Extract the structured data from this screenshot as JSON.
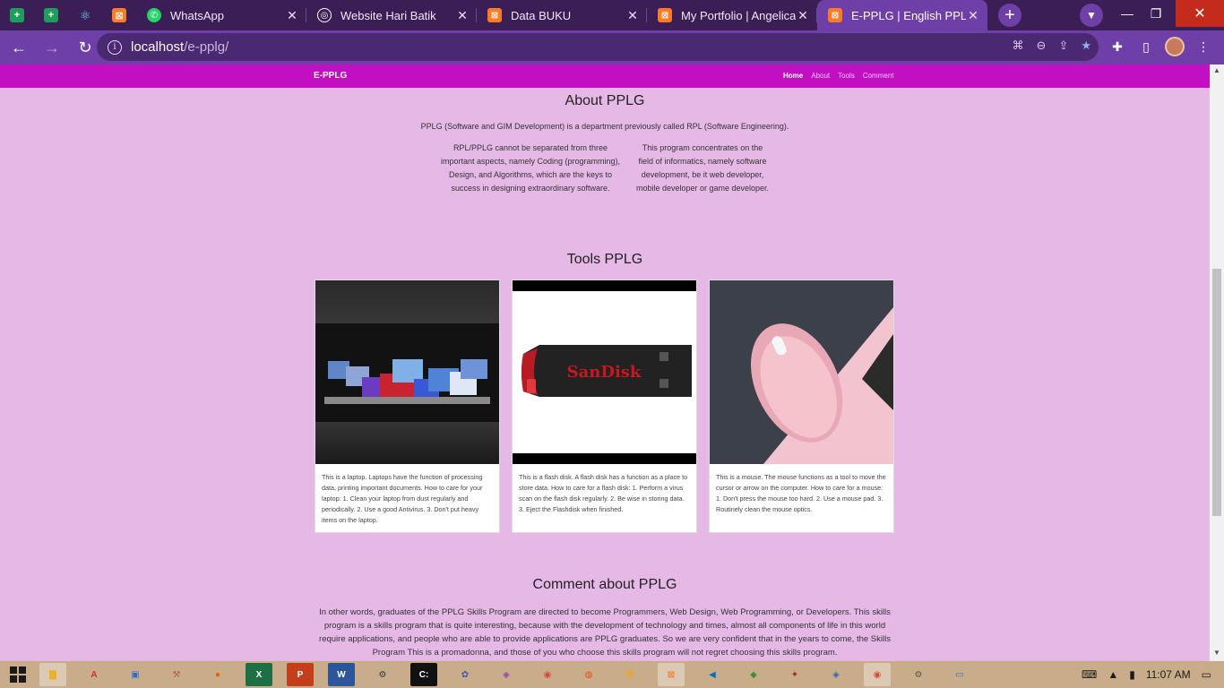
{
  "browser": {
    "tabs": [
      {
        "title": "WhatsApp",
        "icon": "whatsapp-icon",
        "color": "#25d366"
      },
      {
        "title": "Website Hari Batik",
        "icon": "globe-icon",
        "color": "#2b2b2b"
      },
      {
        "title": "Data BUKU",
        "icon": "xampp-icon",
        "color": "#fb7a24"
      },
      {
        "title": "My Portfolio | Angelica I",
        "icon": "xampp-icon",
        "color": "#fb7a24"
      },
      {
        "title": "E-PPLG | English PPLG",
        "icon": "xampp-icon",
        "color": "#fb7a24"
      }
    ],
    "url_host": "localhost",
    "url_path": "/e-pplg/"
  },
  "site": {
    "brand": "E-PPLG",
    "nav": [
      "Home",
      "About",
      "Tools",
      "Comment"
    ],
    "accent": "#c20fc2",
    "background": "#e6b8e6"
  },
  "about": {
    "title": "About PPLG",
    "lead": "PPLG (Software and GIM Development) is a department previously called RPL (Software Engineering).",
    "col1": "RPL/PPLG cannot be separated from three important aspects, namely Coding (programming), Design, and Algorithms, which are the keys to success in designing extraordinary software.",
    "col2": "This program concentrates on the field of informatics, namely software development, be it web developer, mobile developer or game developer."
  },
  "tools": {
    "title": "Tools PPLG",
    "cards": [
      {
        "text": "This is a laptop. Laptops have the function of processing data, printing important documents. How to care for your laptop: 1. Clean your laptop from dust regularly and periodically. 2. Use a good Antivirus. 3. Don't put heavy items on the laptop."
      },
      {
        "text": "This is a flash disk. A flash disk has a function as a place to store data. How to care for a flash disk: 1. Perform a virus scan on the flash disk regularly. 2. Be wise in storing data. 3. Eject the Flashdisk when finished.",
        "brand": "SanDisk"
      },
      {
        "text": "This is a mouse. The mouse functions as a tool to move the cursor or arrow on the computer. How to care for a mouse: 1. Don't press the mouse too hard. 2. Use a mouse pad. 3. Routinely clean the mouse optics."
      }
    ]
  },
  "comment": {
    "title": "Comment about PPLG",
    "text": "In other words, graduates of the PPLG Skills Program are directed to become Programmers, Web Design, Web Programming, or Developers. This skills program is a skills program that is quite interesting, because with the development of technology and times, almost all components of life in this world require applications, and people who are able to provide applications are PPLG graduates. So we are very confident that in the years to come, the Skills Program This is a promadonna, and those of you who choose this skills program will not regret choosing this skills program."
  },
  "taskbar": {
    "time": "11:07 AM"
  }
}
